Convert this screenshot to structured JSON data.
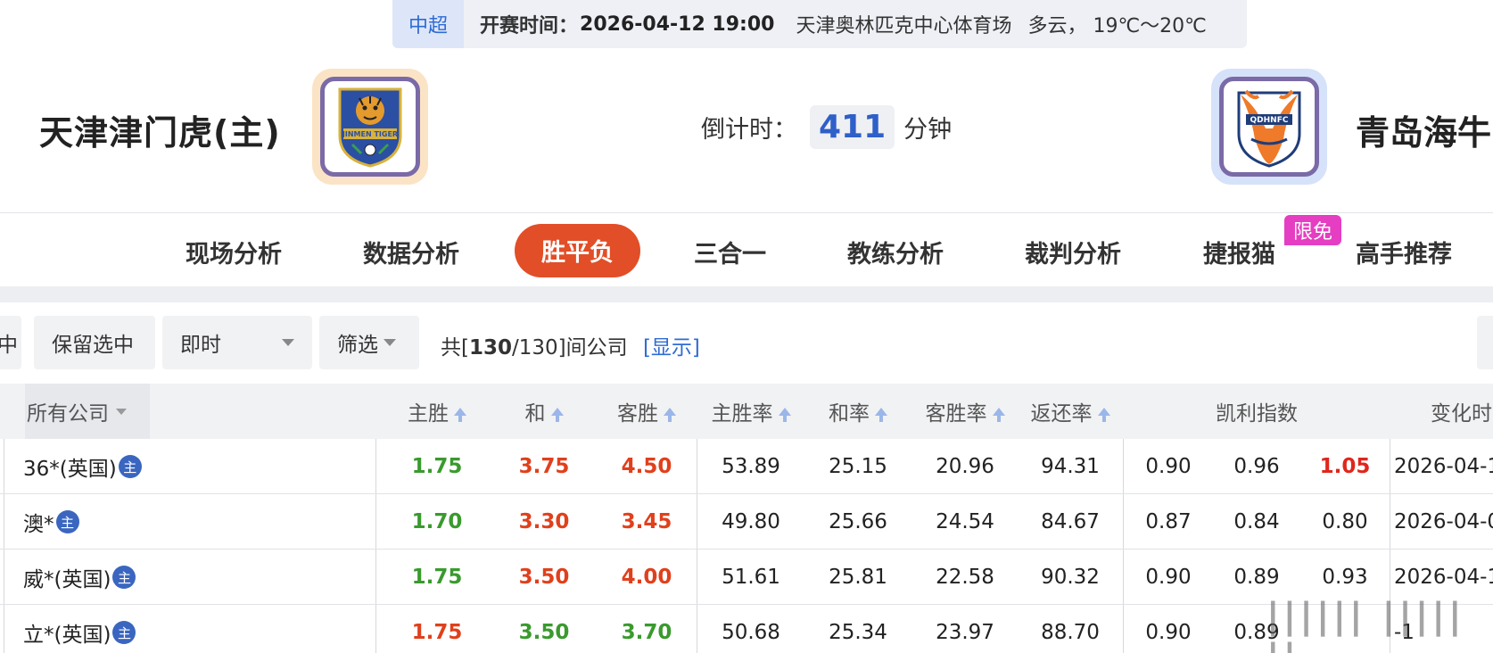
{
  "match": {
    "league": "中超",
    "kickoff_label": "开赛时间：",
    "kickoff_time": "2026-04-12 19:00",
    "venue": "天津奥林匹克中心体育场",
    "weather": "多云， 19℃～20℃",
    "home_team": "天津津门虎(主)",
    "away_team": "青岛海牛",
    "countdown_label": "倒计时：",
    "countdown_value": "411",
    "countdown_unit": "分钟",
    "home_logo_text": "JINMEN TIGER",
    "away_logo_text": "QDHNFC"
  },
  "nav": {
    "items": [
      "现场分析",
      "数据分析",
      "胜平负",
      "三合一",
      "教练分析",
      "裁判分析",
      "捷报猫",
      "高手推荐"
    ],
    "active": "胜平负",
    "free_badge": "限免"
  },
  "toolbar": {
    "partial_label": "中",
    "keep_selected": "保留选中",
    "mode": "即时",
    "filter": "筛选",
    "total_prefix": "共[",
    "total_selected": "130",
    "total_rest": "/130]间公司",
    "show_link": "[显示]"
  },
  "table": {
    "headers": {
      "company": "所有公司",
      "home_win": "主胜",
      "draw": "和",
      "away_win": "客胜",
      "home_rate": "主胜率",
      "draw_rate": "和率",
      "away_rate": "客胜率",
      "return_rate": "返还率",
      "kelly": "凯利指数",
      "change_time": "变化时"
    },
    "host_icon": "主",
    "rows": [
      {
        "company": "36*(英国)",
        "odds": [
          "1.75",
          "3.75",
          "4.50"
        ],
        "odds_colors": [
          "green",
          "red",
          "red"
        ],
        "rates": [
          "53.89",
          "25.15",
          "20.96",
          "94.31"
        ],
        "kelly": [
          "0.90",
          "0.96",
          "1.05"
        ],
        "kelly_hl": [
          false,
          false,
          true
        ],
        "time": "2026-04-1"
      },
      {
        "company": "澳*",
        "odds": [
          "1.70",
          "3.30",
          "3.45"
        ],
        "odds_colors": [
          "green",
          "red",
          "red"
        ],
        "rates": [
          "49.80",
          "25.66",
          "24.54",
          "84.67"
        ],
        "kelly": [
          "0.87",
          "0.84",
          "0.80"
        ],
        "kelly_hl": [
          false,
          false,
          false
        ],
        "time": "2026-04-0"
      },
      {
        "company": "威*(英国)",
        "odds": [
          "1.75",
          "3.50",
          "4.00"
        ],
        "odds_colors": [
          "green",
          "red",
          "red"
        ],
        "rates": [
          "51.61",
          "25.81",
          "22.58",
          "90.32"
        ],
        "kelly": [
          "0.90",
          "0.89",
          "0.93"
        ],
        "kelly_hl": [
          false,
          false,
          false
        ],
        "time": "2026-04-1"
      },
      {
        "company": "立*(英国)",
        "odds": [
          "1.75",
          "3.50",
          "3.70"
        ],
        "odds_colors": [
          "red",
          "green",
          "green"
        ],
        "rates": [
          "50.68",
          "25.34",
          "23.97",
          "88.70"
        ],
        "kelly": [
          "0.90",
          "0.89",
          ""
        ],
        "kelly_hl": [
          false,
          false,
          false
        ],
        "time": "-1"
      }
    ]
  },
  "watermark": "|||||| ||||| ||",
  "colors": {
    "accent": "#e24e27",
    "win_green": "#3a9a2e",
    "loss_red": "#e0401c",
    "link_blue": "#2f6bd4"
  }
}
